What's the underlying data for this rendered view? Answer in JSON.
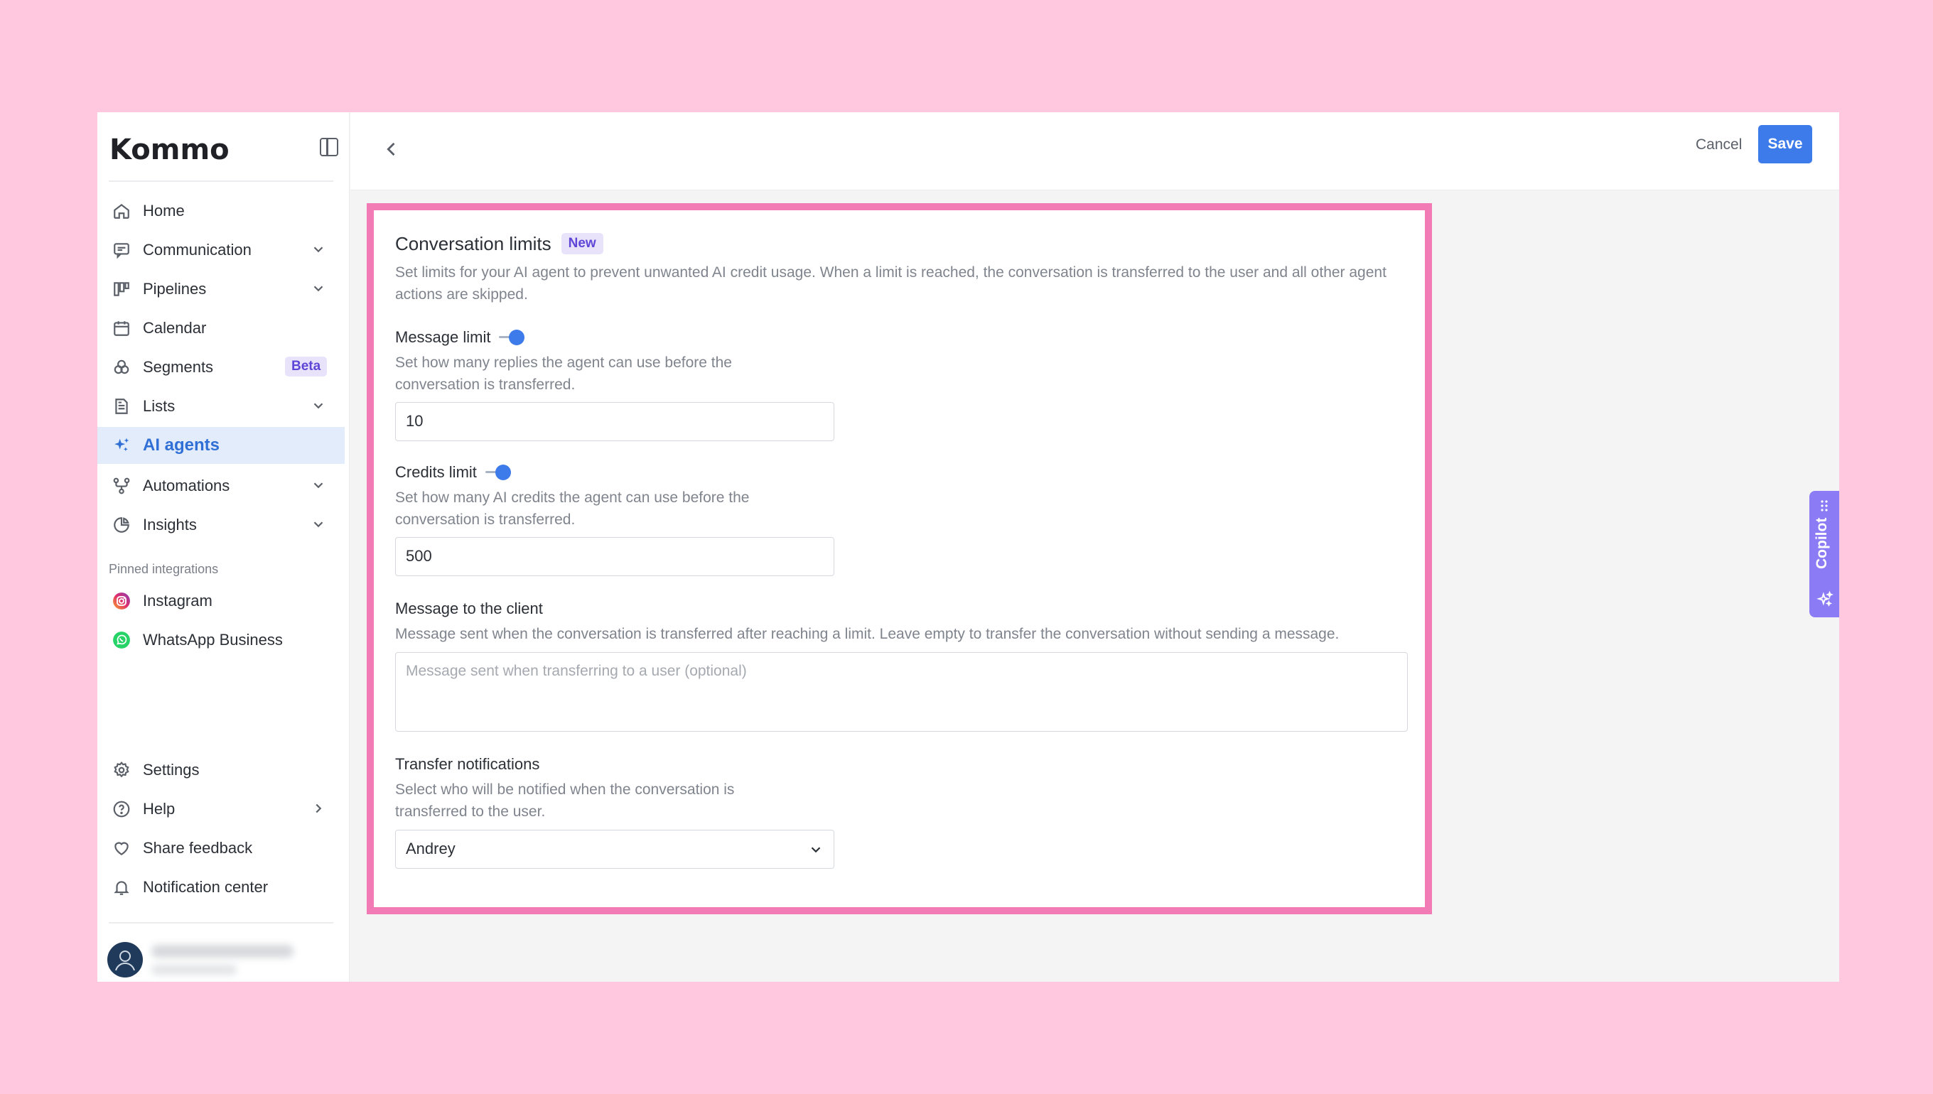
{
  "app": {
    "logo": "Kommo"
  },
  "sidebar": {
    "items": [
      {
        "label": "Home",
        "icon": "home-icon"
      },
      {
        "label": "Communication",
        "icon": "chat-icon",
        "expandable": true
      },
      {
        "label": "Pipelines",
        "icon": "pipelines-icon",
        "expandable": true
      },
      {
        "label": "Calendar",
        "icon": "calendar-icon"
      },
      {
        "label": "Segments",
        "icon": "segments-icon",
        "badge": "Beta"
      },
      {
        "label": "Lists",
        "icon": "list-icon",
        "expandable": true
      },
      {
        "label": "AI agents",
        "icon": "sparkle-icon",
        "active": true
      },
      {
        "label": "Automations",
        "icon": "automations-icon",
        "expandable": true
      },
      {
        "label": "Insights",
        "icon": "insights-icon",
        "expandable": true
      }
    ],
    "pinned_label": "Pinned integrations",
    "pinned": [
      {
        "label": "Instagram",
        "icon": "instagram-icon"
      },
      {
        "label": "WhatsApp Business",
        "icon": "whatsapp-icon"
      }
    ],
    "bottom": [
      {
        "label": "Settings",
        "icon": "gear-icon"
      },
      {
        "label": "Help",
        "icon": "help-icon"
      },
      {
        "label": "Share feedback",
        "icon": "heart-icon"
      },
      {
        "label": "Notification center",
        "icon": "bell-icon"
      }
    ]
  },
  "toolbar": {
    "cancel_label": "Cancel",
    "save_label": "Save"
  },
  "limits": {
    "title": "Conversation limits",
    "badge": "New",
    "description": "Set limits for your AI agent to prevent unwanted AI credit usage. When a limit is reached, the conversation is transferred to the user and all other agent actions are skipped.",
    "message_limit": {
      "label": "Message limit",
      "enabled": true,
      "description": "Set how many replies the agent can use before the conversation is transferred.",
      "value": "10"
    },
    "credits_limit": {
      "label": "Credits limit",
      "enabled": true,
      "description": "Set how many AI credits the agent can use before the conversation is transferred.",
      "value": "500"
    },
    "client_message": {
      "label": "Message to the client",
      "description": "Message sent when the conversation is transferred after reaching a limit. Leave empty to transfer the conversation without sending a message.",
      "placeholder": "Message sent when transferring to a user (optional)"
    },
    "notifications": {
      "label": "Transfer notifications",
      "description": "Select who will be notified when the conversation is transferred to the user.",
      "selected": "Andrey"
    }
  },
  "copilot": {
    "label": "Copilot"
  },
  "colors": {
    "accent": "#3d7bea",
    "highlight_border": "#f27bb5",
    "badge_bg": "#e8e3fb",
    "badge_text": "#5f46d6",
    "copilot": "#8b7cf6",
    "background": "#ffc8df"
  }
}
